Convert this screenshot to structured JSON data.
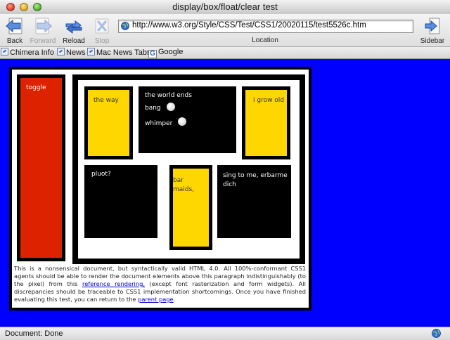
{
  "window": {
    "title": "display/box/float/clear test"
  },
  "toolbar": {
    "back_label": "Back",
    "forward_label": "Forward",
    "reload_label": "Reload",
    "stop_label": "Stop",
    "location_label": "Location",
    "sidebar_label": "Sidebar",
    "url": "http://www.w3.org/Style/CSS/Test/CSS1/20020115/test5526c.htm"
  },
  "bookmarks": [
    {
      "label": "Chimera Info"
    },
    {
      "label": "News"
    },
    {
      "label": "Mac News Tabs"
    },
    {
      "label": "Google"
    }
  ],
  "page": {
    "background_color": "#0000ff",
    "toggle": "toggle",
    "the_way": "the way",
    "world_ends": "the world ends",
    "bang": "bang",
    "whimper": "whimper",
    "i_grow_old": "i grow old",
    "pluot": "pluot?",
    "bar_maids": "bar maids,",
    "sing": "sing to me, erbarme dich",
    "paragraph": {
      "part1": "This is a nonsensical document, but syntactically valid HTML 4.0. All 100%-conformant CSS1 agents should be able to render the document elements above this paragraph indistinguishably (to the pixel) from this ",
      "link1": "reference rendering,",
      "part2": " (except font rasterization and form widgets). All discrepancies should be traceable to CSS1 implementation shortcomings. Once you have finished evaluating this test, you can return to the ",
      "link2": "parent page",
      "part3": "."
    }
  },
  "status": {
    "text": "Document: Done"
  },
  "colors": {
    "red": "#dd2200",
    "yellow": "#ffd700",
    "blue": "#0000ff",
    "black": "#000000"
  }
}
